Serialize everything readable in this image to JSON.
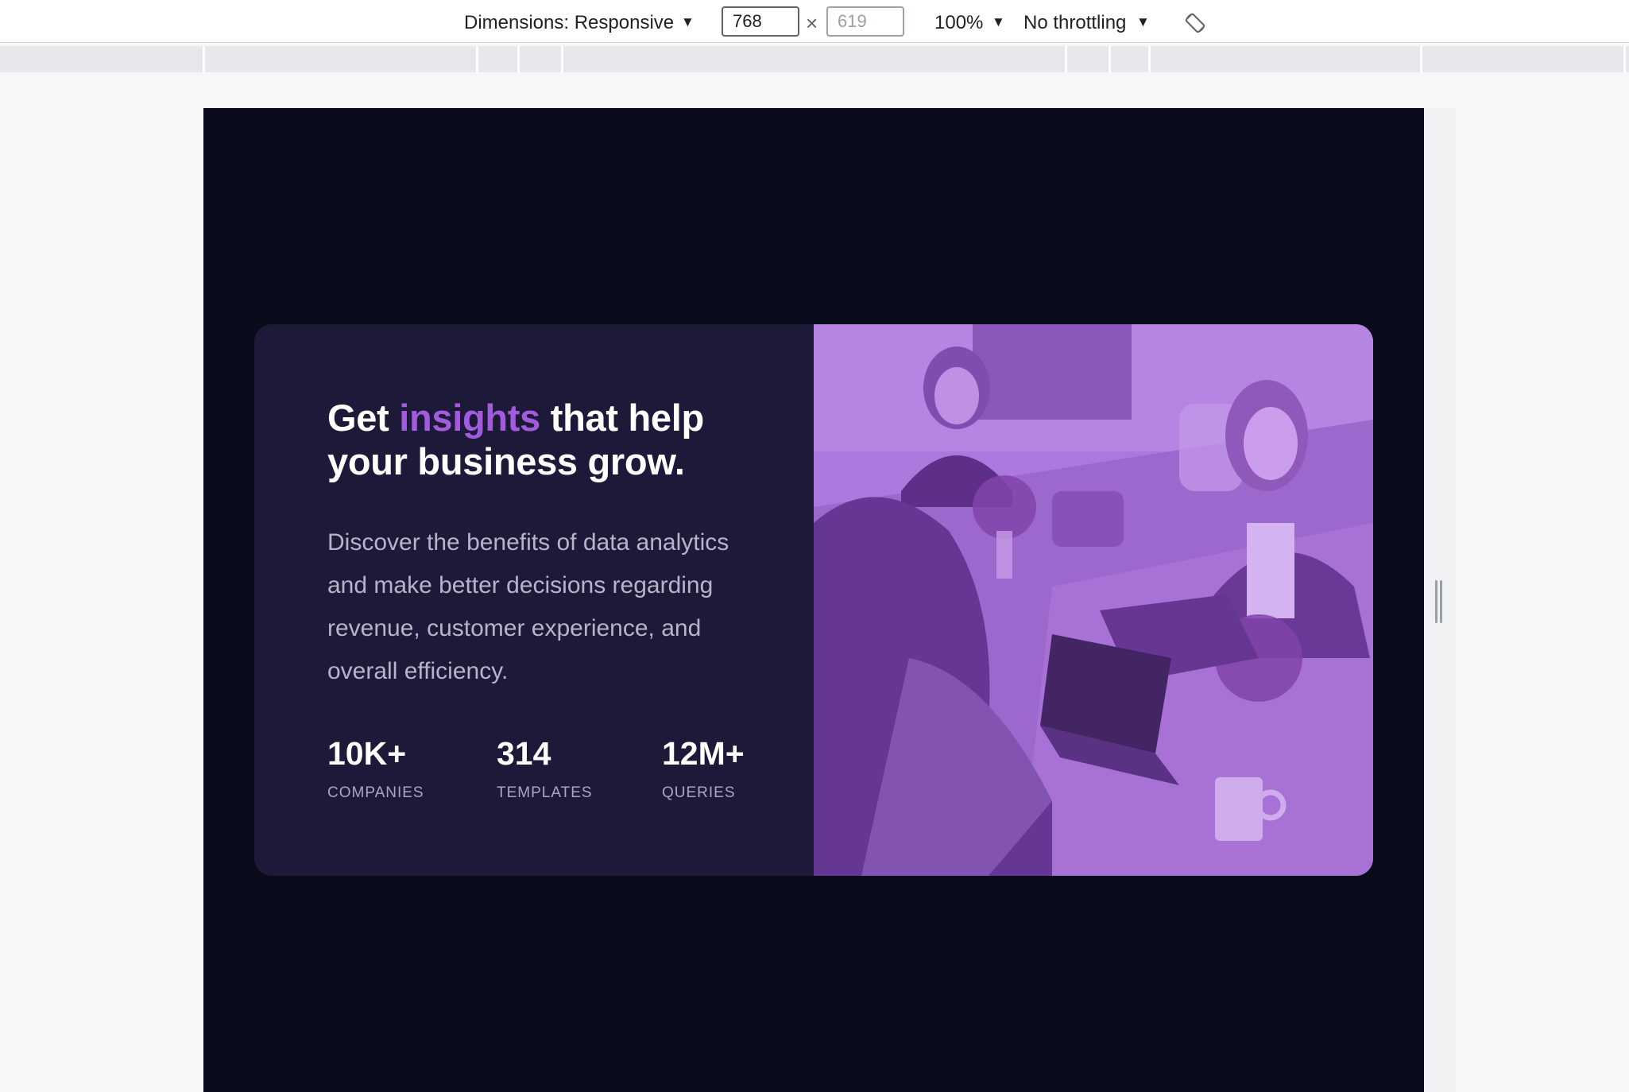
{
  "devtools": {
    "dimensions_label": "Dimensions: Responsive",
    "width_value": "768",
    "height_placeholder": "619",
    "zoom_label": "100%",
    "throttling_label": "No throttling",
    "rotate_icon": "rotate-icon"
  },
  "card": {
    "headline_before": "Get ",
    "headline_accent": "insights",
    "headline_after": " that help your business grow.",
    "description": "Discover the benefits of data analytics and make better decisions regarding revenue, customer experience, and overall efficiency.",
    "stats": [
      {
        "value": "10K+",
        "label": "COMPANIES"
      },
      {
        "value": "314",
        "label": "TEMPLATES"
      },
      {
        "value": "12M+",
        "label": "QUERIES"
      }
    ],
    "image_description_icon": "office-team-photo"
  },
  "colors": {
    "page_background": "#090b1a",
    "card_background": "#1c1a38",
    "accent": "#a35bdd",
    "image_tint": "#aa5cdb"
  }
}
